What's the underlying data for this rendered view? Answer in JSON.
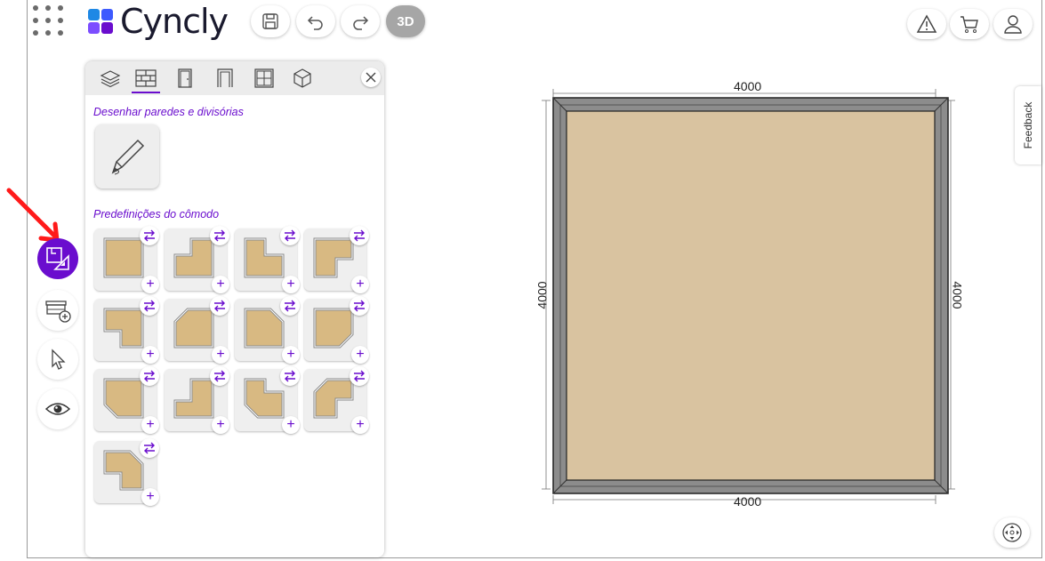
{
  "app": {
    "brand": "Cyncly"
  },
  "toolbar": {
    "three_d_label": "3D"
  },
  "panel": {
    "tabs": [
      "layers",
      "walls",
      "doors",
      "openings",
      "windows",
      "3d-objects"
    ],
    "active_tab": "walls",
    "section_draw": "Desenhar paredes e divisórias",
    "section_presets": "Predefinições do cômodo",
    "presets_count": 13,
    "plus_symbol": "+"
  },
  "canvas": {
    "dim_top": "4000",
    "dim_bottom": "4000",
    "dim_left": "4000",
    "dim_right": "4000",
    "floor_color": "#d9c3a0",
    "wall_color": "#8c8c8c"
  },
  "feedback_label": "Feedback",
  "accent_color": "#6a0dce"
}
